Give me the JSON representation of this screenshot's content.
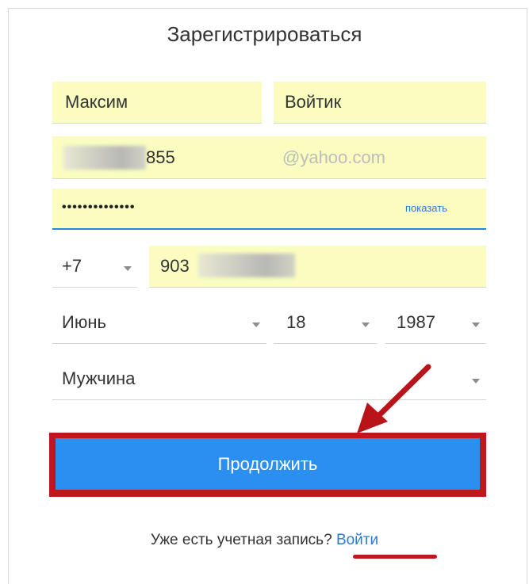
{
  "title": "Зарегистрироваться",
  "form": {
    "first_name": "Максим",
    "last_name": "Войтик",
    "email_visible": "855",
    "email_domain": "@yahoo.com",
    "password_masked": "••••••••••••••",
    "show_password_label": "показать",
    "phone_code": "+7",
    "phone_visible": "903",
    "birth_month": "Июнь",
    "birth_day": "18",
    "birth_year": "1987",
    "gender": "Мужчина"
  },
  "submit_label": "Продолжить",
  "footer": {
    "prompt": "Уже есть учетная запись?",
    "login_link": "Войти"
  },
  "colors": {
    "field_autofill": "#fafcc0",
    "primary_button": "#2a8ff1",
    "annotation_red": "#c0171d",
    "link": "#2b7bd6"
  },
  "annotation": {
    "arrow_icon": "red-arrow-pointing-to-button"
  }
}
